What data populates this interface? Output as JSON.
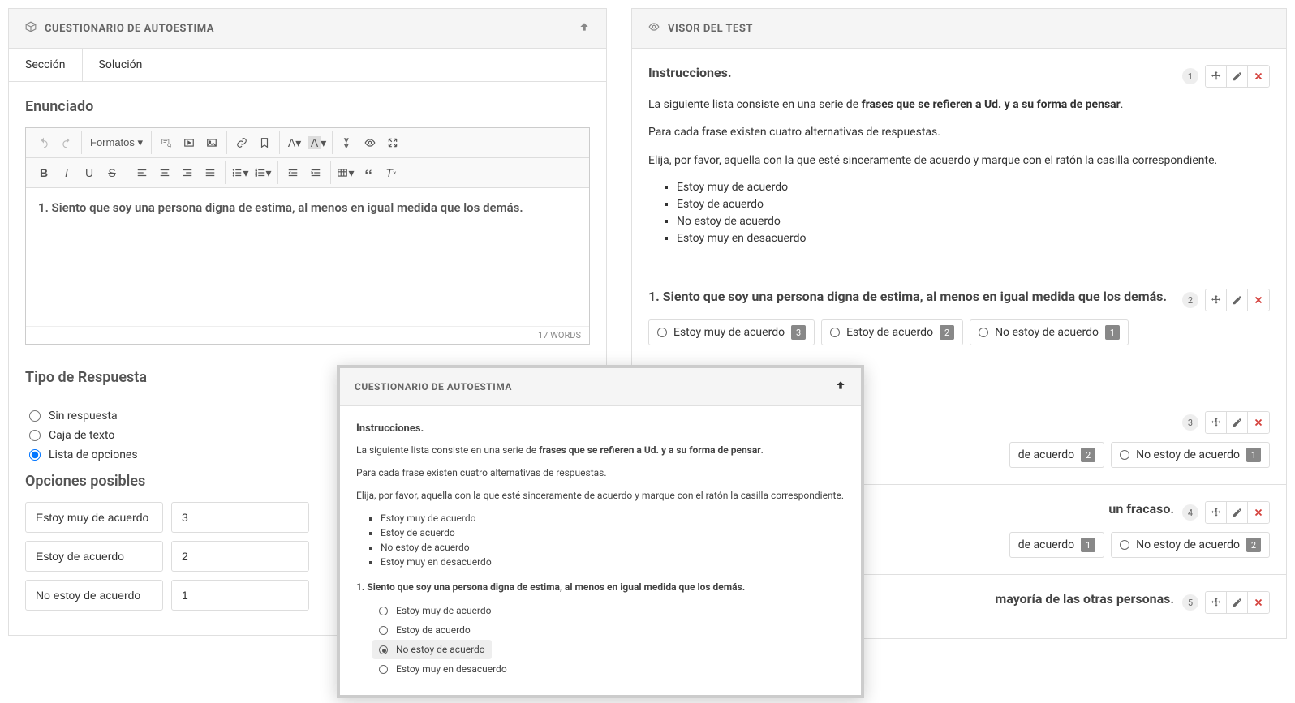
{
  "left_panel": {
    "title": "CUESTIONARIO DE AUTOESTIMA",
    "tabs": [
      {
        "label": "Sección",
        "active": true
      },
      {
        "label": "Solución",
        "active": false
      }
    ],
    "statement_title": "Enunciado",
    "formats_label": "Formatos",
    "editor_content": "1. Siento que soy una persona digna de estima, al menos en igual medida que los demás.",
    "word_count": "17 WORDS",
    "response_type_title": "Tipo de Respuesta",
    "response_types": [
      {
        "label": "Sin respuesta",
        "checked": false
      },
      {
        "label": "Caja de texto",
        "checked": false
      },
      {
        "label": "Lista de opciones",
        "checked": true
      }
    ],
    "options_title": "Opciones posibles",
    "options": [
      {
        "text": "Estoy muy de acuerdo",
        "value": "3"
      },
      {
        "text": "Estoy de acuerdo",
        "value": "2"
      },
      {
        "text": "No estoy de acuerdo",
        "value": "1"
      }
    ]
  },
  "right_panel": {
    "title": "VISOR DEL TEST",
    "blocks": [
      {
        "num": "1",
        "title": "Instrucciones.",
        "intro_prefix": "La siguiente lista consiste en una serie de ",
        "intro_bold": "frases que se refieren a Ud. y a su forma de pensar",
        "intro_suffix": ".",
        "p2": "Para cada frase existen cuatro alternativas de respuestas.",
        "p3": "Elija, por favor, aquella con la que esté sinceramente de acuerdo y marque con el ratón la casilla correspondiente.",
        "bullets": [
          "Estoy muy de acuerdo",
          "Estoy de acuerdo",
          "No estoy de acuerdo",
          "Estoy muy en desacuerdo"
        ]
      },
      {
        "num": "2",
        "title": "1. Siento que soy una persona digna de estima, al menos en igual medida que los demás.",
        "answers": [
          {
            "label": "Estoy muy de acuerdo",
            "badge": "3"
          },
          {
            "label": "Estoy de acuerdo",
            "badge": "2"
          },
          {
            "label": "No estoy de acuerdo",
            "badge": "1"
          }
        ]
      },
      {
        "num": "3",
        "title_suffix": "",
        "answers": [
          {
            "label": "de acuerdo",
            "badge": "2"
          },
          {
            "label": "No estoy de acuerdo",
            "badge": "1"
          }
        ]
      },
      {
        "num": "4",
        "title_suffix": "un fracaso.",
        "answers": [
          {
            "label": "de acuerdo",
            "badge": "1"
          },
          {
            "label": "No estoy de acuerdo",
            "badge": "2"
          }
        ]
      },
      {
        "num": "5",
        "title_suffix": "mayoría de las otras personas."
      }
    ]
  },
  "modal": {
    "title": "CUESTIONARIO DE AUTOESTIMA",
    "inst_title": "Instrucciones.",
    "p1_prefix": "La siguiente lista consiste en una serie de ",
    "p1_bold": "frases que se refieren a Ud. y a su forma de pensar",
    "p1_suffix": ".",
    "p2": "Para cada frase existen cuatro alternativas de respuestas.",
    "p3": "Elija, por favor, aquella con la que esté sinceramente de acuerdo y marque con el ratón la casilla correspondiente.",
    "bullets": [
      "Estoy muy de acuerdo",
      "Estoy de acuerdo",
      "No estoy de acuerdo",
      "Estoy muy en desacuerdo"
    ],
    "q1_title": "1. Siento que soy una persona digna de estima, al menos en igual medida que los demás.",
    "q1_answers": [
      {
        "label": "Estoy muy de acuerdo",
        "selected": false
      },
      {
        "label": "Estoy de acuerdo",
        "selected": false
      },
      {
        "label": "No estoy de acuerdo",
        "selected": true
      },
      {
        "label": "Estoy muy en desacuerdo",
        "selected": false
      }
    ]
  }
}
